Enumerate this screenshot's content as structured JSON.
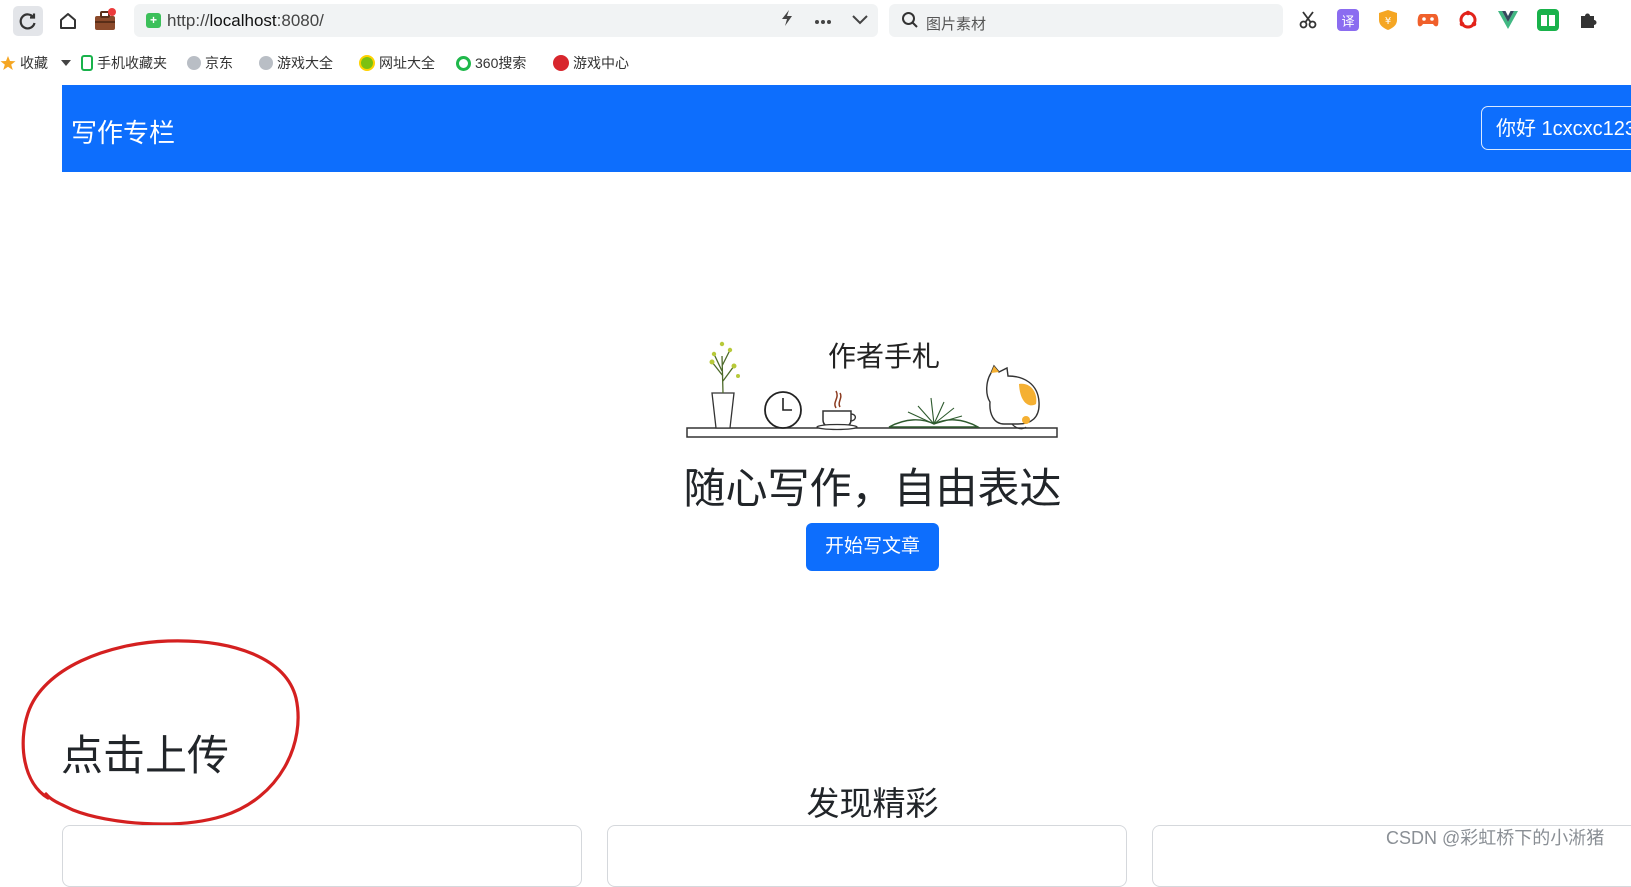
{
  "browser": {
    "url_scheme": "http://",
    "url_host": "localhost",
    "url_rest": ":8080/",
    "search_placeholder": "图片素材",
    "icons": [
      "reload-icon",
      "home-icon",
      "briefcase-icon",
      "lightning-icon",
      "more-icon",
      "chevron-down-icon",
      "search-icon",
      "scissors-icon",
      "translate-icon",
      "shield-extension-icon",
      "game-extension-icon",
      "huawei-extension-icon",
      "vue-devtools-icon",
      "green-book-icon",
      "puzzle-icon"
    ],
    "ext_translate_label": "译"
  },
  "bookmarks": [
    {
      "label": "收藏"
    },
    {
      "label": "手机收藏夹"
    },
    {
      "label": "京东"
    },
    {
      "label": "游戏大全"
    },
    {
      "label": "网址大全"
    },
    {
      "label": "360搜索"
    },
    {
      "label": "游戏中心"
    }
  ],
  "navbar": {
    "brand": "写作专栏",
    "greeting": "你好 1cxcxc123"
  },
  "hero": {
    "logo_title": "作者手札",
    "slogan": "随心写作，自由表达",
    "cta_label": "开始写文章"
  },
  "upload": {
    "label": "点击上传",
    "annotation_color": "#d42020"
  },
  "discover": {
    "title": "发现精彩"
  },
  "watermark": "CSDN @彩虹桥下的小淅猪",
  "colors": {
    "primary": "#0d6efd",
    "text": "#212529"
  }
}
